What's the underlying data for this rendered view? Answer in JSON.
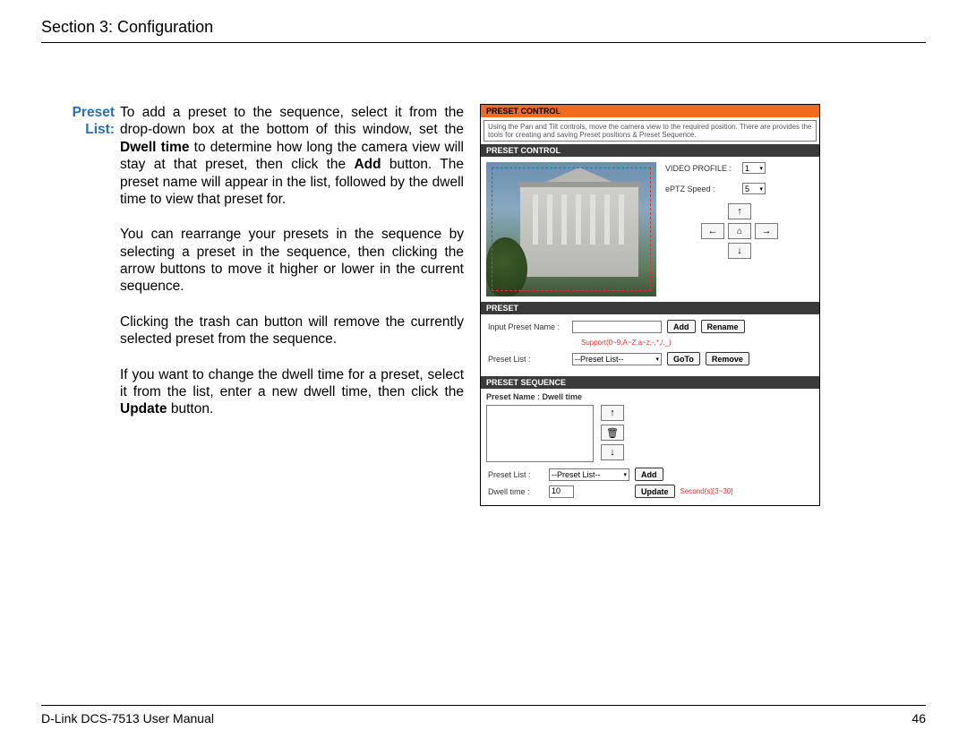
{
  "header": {
    "title": "Section 3: Configuration"
  },
  "label": "Preset List:",
  "paragraphs": {
    "p1a": "To add a preset to the sequence, select it from the drop-down box at the bottom of this window, set the ",
    "p1bold1": "Dwell time",
    "p1b": " to determine how long the camera view will stay at that preset, then click the ",
    "p1bold2": "Add",
    "p1c": " button. The preset name will appear in the list, followed by the dwell time to view that preset for.",
    "p2": "You can rearrange your presets in the sequence by selecting a preset in the sequence, then clicking the arrow buttons to move it higher or lower in the current sequence.",
    "p3": "Clicking the trash can button will remove the currently selected preset from the sequence.",
    "p4a": "If you want to change the dwell time for a preset, select it from the list, enter a new dwell time, then click the ",
    "p4bold": "Update",
    "p4b": " button."
  },
  "ui": {
    "orange_title": "PRESET CONTROL",
    "hint": "Using the Pan and Tilt controls, move the camera view to the required position. There are provides the tools for creating and saving Preset positions & Preset Sequence.",
    "dark1": "PRESET CONTROL",
    "video_profile_label": "VIDEO PROFILE  :",
    "video_profile_value": "1",
    "eptz_label": "ePTZ Speed        :",
    "eptz_value": "5",
    "arrows": {
      "up": "↑",
      "left": "←",
      "right": "→",
      "down": "↓",
      "home": "⌂"
    },
    "dark2": "PRESET",
    "input_preset_label": "Input Preset Name :",
    "add_btn": "Add",
    "rename_btn": "Rename",
    "support_text": "Support(0~9,A~Z,a~z,-,*,/,_)",
    "preset_list_label": "Preset List :",
    "preset_list_value": "--Preset List--",
    "goto_btn": "GoTo",
    "remove_btn": "Remove",
    "dark3": "PRESET SEQUENCE",
    "seq_header": "Preset Name : Dwell time",
    "seq_up": "↑",
    "seq_trash": "🗑",
    "seq_down": "↓",
    "seq_preset_list_label": "Preset List :",
    "seq_preset_list_value": "--Preset List--",
    "seq_add": "Add",
    "dwell_label": "Dwell time :",
    "dwell_value": "10",
    "update_btn": "Update",
    "seconds_hint": "Second(s)[3~30]"
  },
  "footer": {
    "left": "D-Link DCS-7513 User Manual",
    "right": "46"
  }
}
